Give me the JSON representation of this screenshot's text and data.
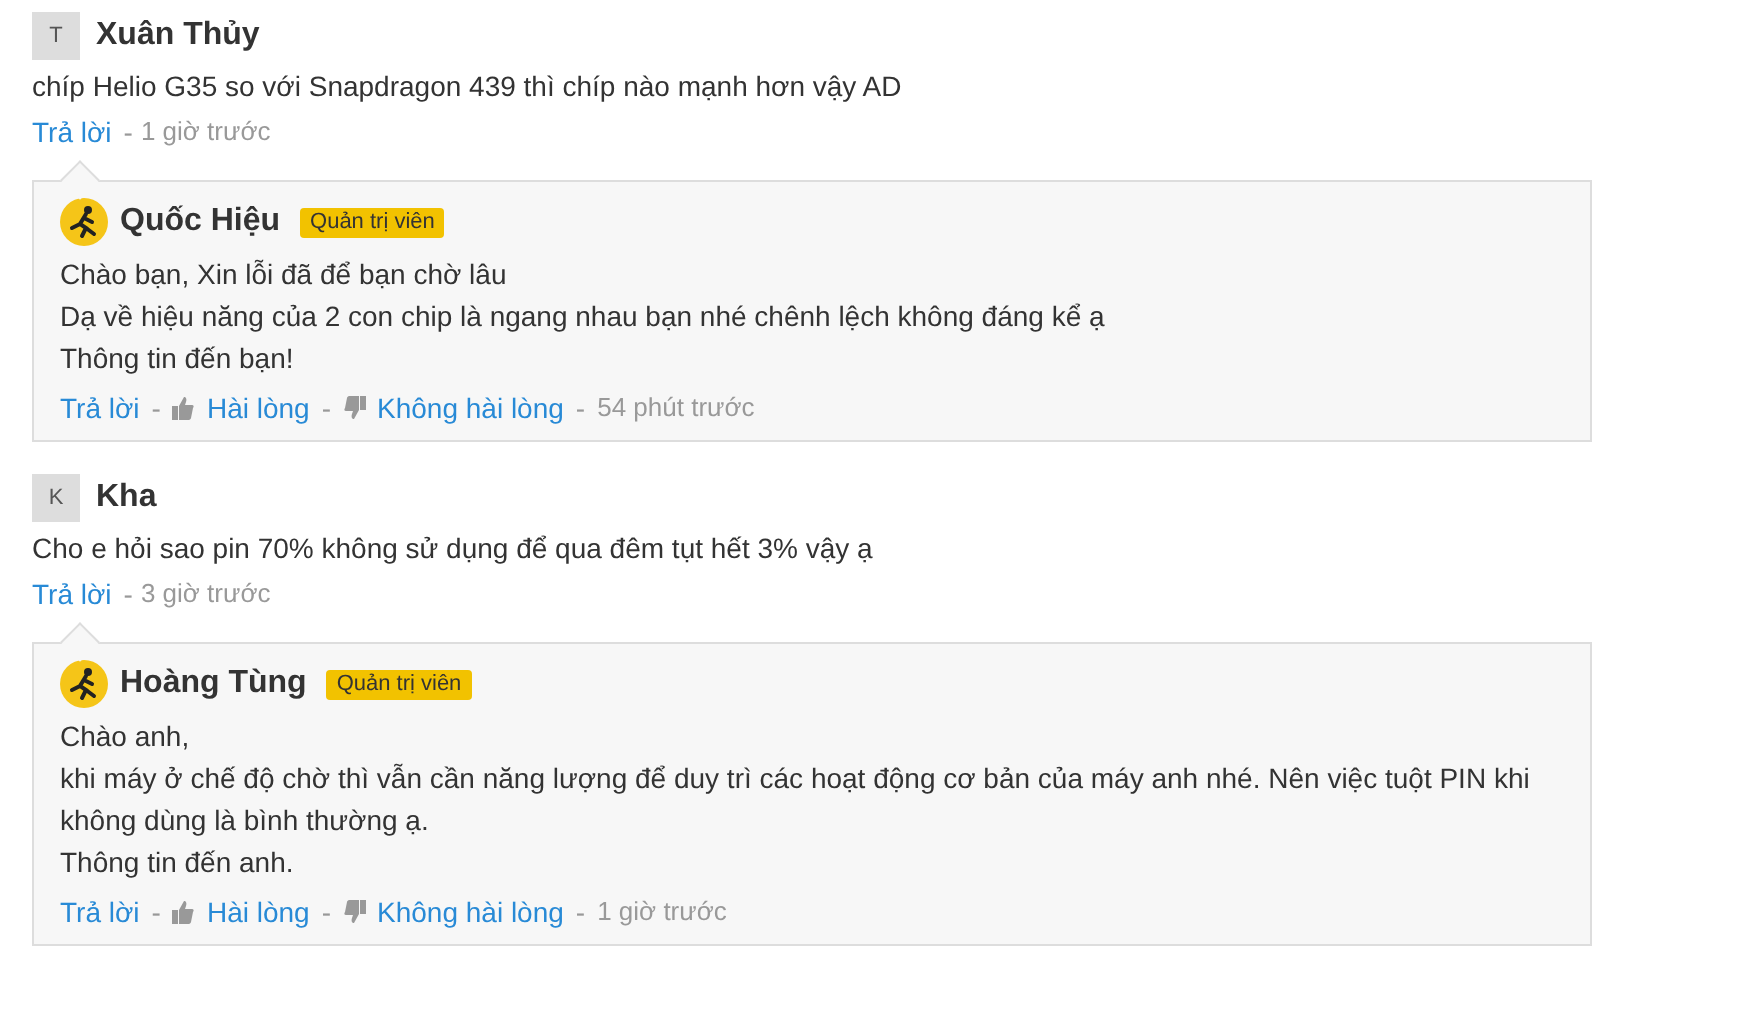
{
  "separator": "-",
  "comments": [
    {
      "initial": "T",
      "name": "Xuân Thủy",
      "text": "chíp Helio G35 so với Snapdragon 439 thì chíp nào mạnh hơn vậy AD",
      "reply_link": "Trả lời",
      "time": "1 giờ trước",
      "reply": {
        "name": "Quốc Hiệu",
        "badge": "Quản trị viên",
        "lines": [
          "Chào bạn, Xin lỗi đã để bạn chờ lâu",
          "Dạ về hiệu năng của 2 con chip là ngang nhau bạn nhé chênh lệch không đáng kể ạ",
          "Thông tin đến bạn!"
        ],
        "reply_link": "Trả lời",
        "like": "Hài lòng",
        "dislike": "Không hài lòng",
        "time": "54 phút trước"
      }
    },
    {
      "initial": "K",
      "name": "Kha",
      "text": "Cho e hỏi sao pin 70% không sử dụng để qua đêm tụt hết 3% vậy ạ",
      "reply_link": "Trả lời",
      "time": "3 giờ trước",
      "reply": {
        "name": "Hoàng Tùng",
        "badge": "Quản trị viên",
        "lines": [
          "Chào anh,",
          "khi máy ở chế độ chờ thì vẫn cần năng lượng để duy trì các hoạt động cơ bản của máy anh nhé. Nên việc tuột PIN khi không dùng là bình thường ạ.",
          "Thông tin đến anh."
        ],
        "reply_link": "Trả lời",
        "like": "Hài lòng",
        "dislike": "Không hài lòng",
        "time": "1 giờ trước"
      }
    }
  ]
}
